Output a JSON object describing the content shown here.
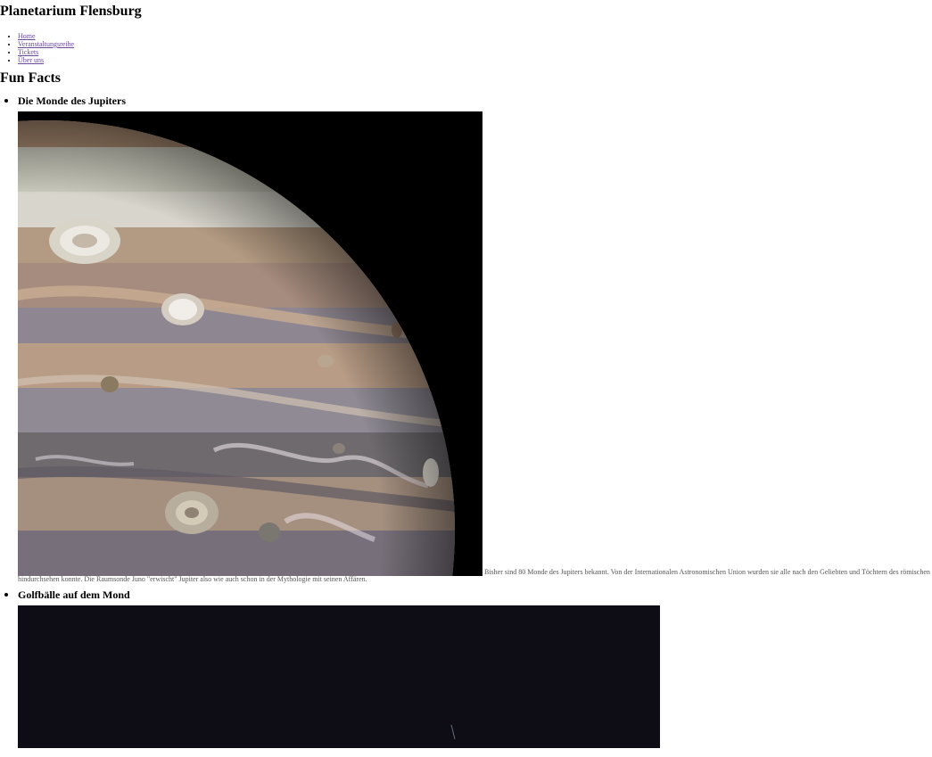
{
  "site": {
    "title": "Planetarium Flensburg"
  },
  "nav": {
    "items": [
      {
        "label": "Home"
      },
      {
        "label": "Veranstaltungsreihe"
      },
      {
        "label": "Tickets"
      },
      {
        "label": "Über uns"
      }
    ]
  },
  "main": {
    "section_title": "Fun Facts",
    "facts": [
      {
        "title": "Die Monde des Jupiters",
        "image_subject": "jupiter-planet-photo",
        "text": "Bisher sind 80 Monde des Jupiters bekannt. Von der Internationalen Astronomischen Union wurden sie alle nach den Geliebten und Töchtern des römischen hindurchsehen konnte. Die Raumsonde Juno \"erwischt\" Jupiter also wie auch schon in der Mythologie mit seinen Affären."
      },
      {
        "title": "Golfbälle auf dem Mond",
        "image_subject": "moon-surface-photo"
      }
    ]
  },
  "colors": {
    "link": "#6b4a9a",
    "image_background": "#000000",
    "moon_background": "#0b0a10"
  }
}
